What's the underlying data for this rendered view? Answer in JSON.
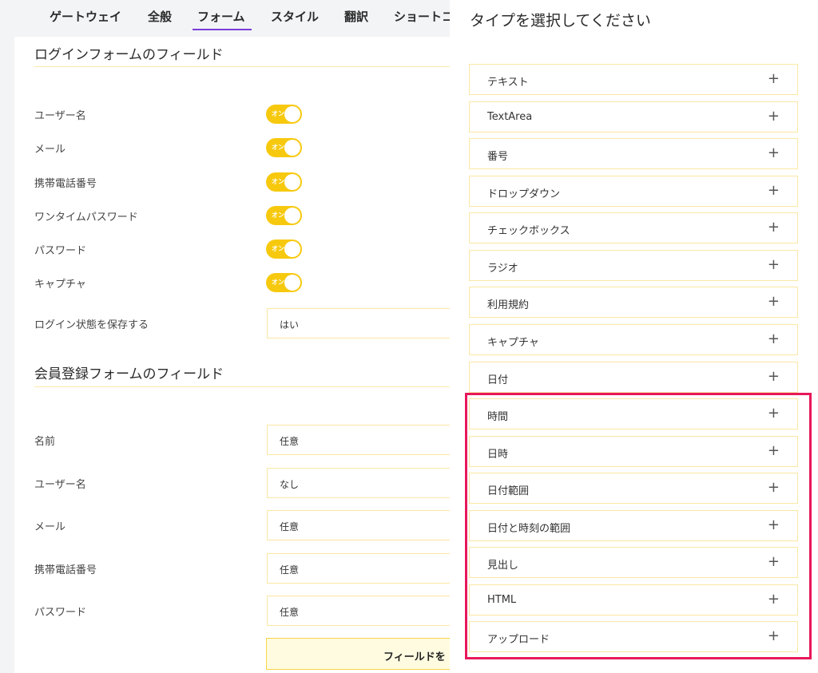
{
  "tabs": [
    "ゲートウェイ",
    "全般",
    "フォーム",
    "スタイル",
    "翻訳",
    "ショートコ"
  ],
  "login_section": {
    "title": "ログインフォームのフィールド",
    "toggle_label": "オン",
    "rows": [
      "ユーザー名",
      "メール",
      "携帯電話番号",
      "ワンタイムパスワード",
      "パスワード",
      "キャプチャ"
    ],
    "remember_label": "ログイン状態を保存する",
    "remember_value": "はい"
  },
  "register_section": {
    "title": "会員登録フォームのフィールド",
    "rows": [
      {
        "label": "名前",
        "value": "任意"
      },
      {
        "label": "ユーザー名",
        "value": "なし"
      },
      {
        "label": "メール",
        "value": "任意"
      },
      {
        "label": "携帯電話番号",
        "value": "任意"
      },
      {
        "label": "パスワード",
        "value": "任意"
      }
    ],
    "add_field_button": "フィールドを"
  },
  "drawer": {
    "title": "タイプを選択してください",
    "plus_symbol": "+",
    "types": [
      "テキスト",
      "TextArea",
      "番号",
      "ドロップダウン",
      "チェックボックス",
      "ラジオ",
      "利用規約",
      "キャプチャ",
      "日付",
      "時間",
      "日時",
      "日付範囲",
      "日付と時刻の範囲",
      "見出し",
      "HTML",
      "アップロード"
    ]
  },
  "colors": {
    "accent_tab": "#7a3ddb",
    "toggle_on": "#f7c90e",
    "field_border": "#fbe7a3",
    "highlight": "#e8185a"
  }
}
